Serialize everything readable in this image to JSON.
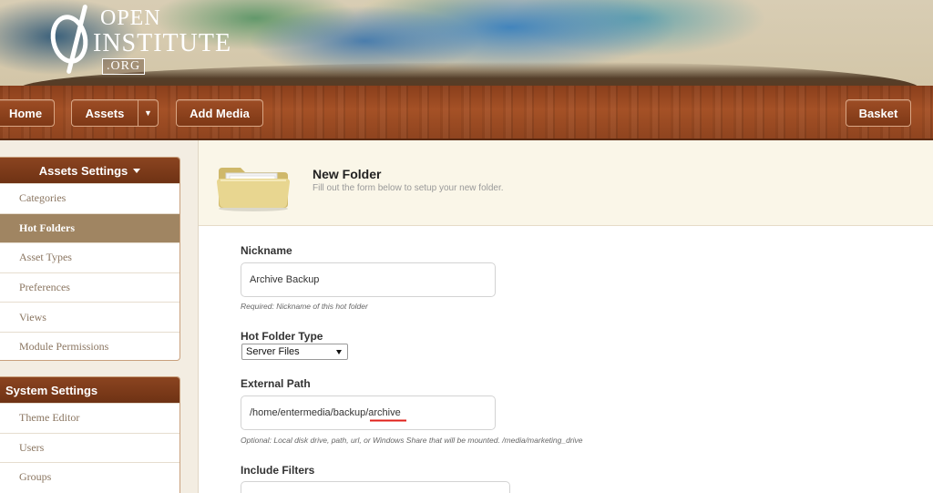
{
  "logo": {
    "line1": "OPEN",
    "line2": "INSTITUTE",
    "line3": ".ORG"
  },
  "nav": {
    "home": "Home",
    "assets": "Assets",
    "add_media": "Add Media",
    "basket": "Basket"
  },
  "sidebar": {
    "assets_settings": {
      "title": "Assets Settings",
      "items": [
        "Categories",
        "Hot Folders",
        "Asset Types",
        "Preferences",
        "Views",
        "Module Permissions"
      ],
      "active": "Hot Folders"
    },
    "system_settings": {
      "title": "System Settings",
      "items": [
        "Theme Editor",
        "Users",
        "Groups"
      ]
    }
  },
  "main": {
    "title": "New Folder",
    "subtitle": "Fill out the form below to setup your new folder.",
    "nickname": {
      "label": "Nickname",
      "value": "Archive Backup",
      "help": "Required: Nickname of this hot folder"
    },
    "folder_type": {
      "label": "Hot Folder Type",
      "selected": "Server Files"
    },
    "external_path": {
      "label": "External Path",
      "value": "/home/entermedia/backup/archive",
      "help": "Optional: Local disk drive, path, url, or Windows Share that will be mounted. /media/marketing_drive"
    },
    "include_filters": {
      "label": "Include Filters",
      "value": ""
    }
  },
  "colors": {
    "nav_wood": "#a55126",
    "sidebar_header": "#7a3a19",
    "active_item": "#a08562",
    "header_bg": "#faf6e8"
  }
}
